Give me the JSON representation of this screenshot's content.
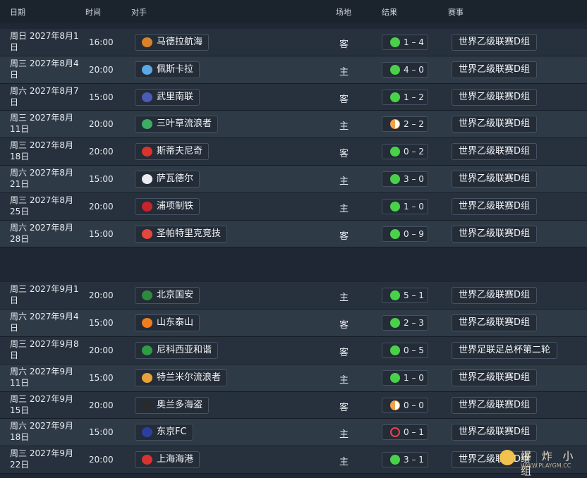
{
  "header": {
    "date": "日期",
    "time": "时间",
    "opponent": "对手",
    "venue": "场地",
    "result": "结果",
    "competition": "赛事"
  },
  "fixtures_aug": [
    {
      "date": "周日 2027年8月1日",
      "time": "16:00",
      "opponent": "马德拉航海",
      "badge_color": "#d9822b",
      "venue": "客",
      "outcome": "win",
      "score": "1 – 4",
      "competition": "世界乙级联赛D组"
    },
    {
      "date": "周三 2027年8月4日",
      "time": "20:00",
      "opponent": "佩斯卡拉",
      "badge_color": "#5aa9e6",
      "venue": "主",
      "outcome": "win",
      "score": "4 – 0",
      "competition": "世界乙级联赛D组"
    },
    {
      "date": "周六 2027年8月7日",
      "time": "15:00",
      "opponent": "武里南联",
      "badge_color": "#4a5bb8",
      "venue": "客",
      "outcome": "win",
      "score": "1 – 2",
      "competition": "世界乙级联赛D组"
    },
    {
      "date": "周三 2027年8月11日",
      "time": "20:00",
      "opponent": "三叶草流浪者",
      "badge_color": "#3cae63",
      "venue": "主",
      "outcome": "draw",
      "score": "2 – 2",
      "competition": "世界乙级联赛D组"
    },
    {
      "date": "周三 2027年8月18日",
      "time": "20:00",
      "opponent": "斯蒂夫尼奇",
      "badge_color": "#d8342f",
      "venue": "客",
      "outcome": "win",
      "score": "0 – 2",
      "competition": "世界乙级联赛D组"
    },
    {
      "date": "周六 2027年8月21日",
      "time": "15:00",
      "opponent": "萨瓦德尔",
      "badge_color": "#e9edf2",
      "venue": "主",
      "outcome": "win",
      "score": "3 – 0",
      "competition": "世界乙级联赛D组"
    },
    {
      "date": "周三 2027年8月25日",
      "time": "20:00",
      "opponent": "浦项制铁",
      "badge_color": "#c8242c",
      "venue": "主",
      "outcome": "win",
      "score": "1 – 0",
      "competition": "世界乙级联赛D组"
    },
    {
      "date": "周六 2027年8月28日",
      "time": "15:00",
      "opponent": "圣帕特里克竞技",
      "badge_color": "#e5473c",
      "venue": "客",
      "outcome": "win",
      "score": "0 – 9",
      "competition": "世界乙级联赛D组"
    }
  ],
  "fixtures_sep": [
    {
      "date": "周三 2027年9月1日",
      "time": "20:00",
      "opponent": "北京国安",
      "badge_color": "#2e8b3e",
      "venue": "主",
      "outcome": "win",
      "score": "5 – 1",
      "competition": "世界乙级联赛D组"
    },
    {
      "date": "周六 2027年9月4日",
      "time": "15:00",
      "opponent": "山东泰山",
      "badge_color": "#f07d1e",
      "venue": "客",
      "outcome": "win",
      "score": "2 – 3",
      "competition": "世界乙级联赛D组"
    },
    {
      "date": "周三 2027年9月8日",
      "time": "20:00",
      "opponent": "尼科西亚和谐",
      "badge_color": "#2f9b45",
      "venue": "客",
      "outcome": "win",
      "score": "0 – 5",
      "competition": "世界足联足总杯第二轮"
    },
    {
      "date": "周六 2027年9月11日",
      "time": "15:00",
      "opponent": "特兰米尔流浪者",
      "badge_color": "#e8a23a",
      "venue": "主",
      "outcome": "win",
      "score": "1 – 0",
      "competition": "世界乙级联赛D组"
    },
    {
      "date": "周三 2027年9月15日",
      "time": "20:00",
      "opponent": "奥兰多海盗",
      "badge_color": "#2a2a2a",
      "venue": "客",
      "outcome": "draw",
      "score": "0 – 0",
      "competition": "世界乙级联赛D组"
    },
    {
      "date": "周六 2027年9月18日",
      "time": "15:00",
      "opponent": "东京FC",
      "badge_color": "#2d3f9e",
      "venue": "主",
      "outcome": "loss",
      "score": "0 – 1",
      "competition": "世界乙级联赛D组"
    },
    {
      "date": "周三 2027年9月22日",
      "time": "20:00",
      "opponent": "上海海港",
      "badge_color": "#d8342f",
      "venue": "主",
      "outcome": "win",
      "score": "3 – 1",
      "competition": "世界乙级联赛D组"
    }
  ],
  "watermark": {
    "text": "爆 炸 小 组",
    "url": "WWW.PLAYGM.CC"
  }
}
